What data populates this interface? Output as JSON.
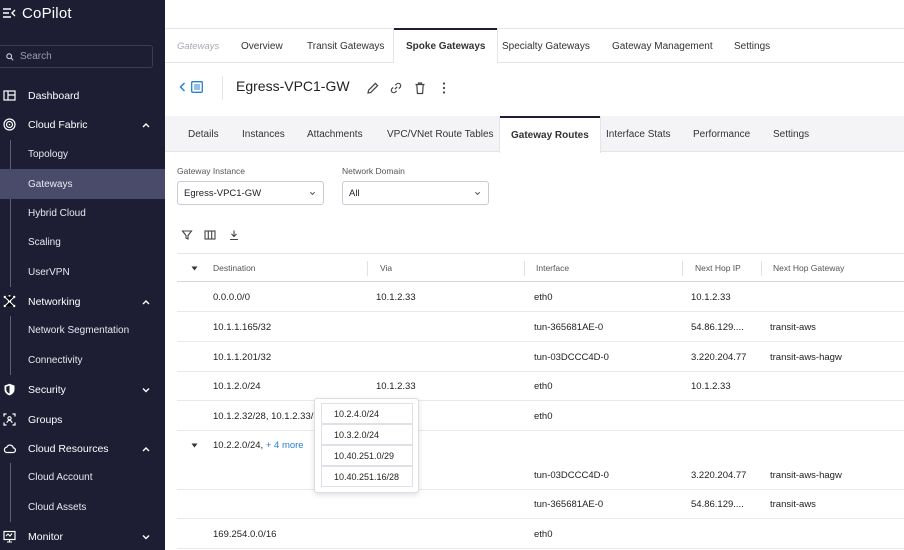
{
  "app": {
    "brand": "CoPilot"
  },
  "sidebar": {
    "search_placeholder": "Search",
    "items": [
      {
        "label": "Dashboard",
        "icon": "dashboard-icon"
      },
      {
        "label": "Cloud Fabric",
        "icon": "cloud-fabric-icon",
        "expanded": true
      },
      {
        "label": "Topology"
      },
      {
        "label": "Gateways",
        "active": true
      },
      {
        "label": "Hybrid Cloud"
      },
      {
        "label": "Scaling"
      },
      {
        "label": "UserVPN"
      },
      {
        "label": "Networking",
        "icon": "networking-icon",
        "expanded": true
      },
      {
        "label": "Network Segmentation"
      },
      {
        "label": "Connectivity"
      },
      {
        "label": "Security",
        "icon": "shield-icon",
        "expanded": false
      },
      {
        "label": "Groups",
        "icon": "groups-icon"
      },
      {
        "label": "Cloud Resources",
        "icon": "cloud-icon",
        "expanded": true
      },
      {
        "label": "Cloud Account"
      },
      {
        "label": "Cloud Assets"
      },
      {
        "label": "Monitor",
        "icon": "monitor-icon",
        "expanded": false
      }
    ]
  },
  "top_tabs": {
    "breadcrumb": "Gateways",
    "tabs": [
      "Overview",
      "Transit Gateways",
      "Spoke Gateways",
      "Specialty Gateways",
      "Gateway Management",
      "Settings"
    ],
    "active": "Spoke Gateways"
  },
  "header": {
    "title": "Egress-VPC1-GW"
  },
  "sub_tabs": {
    "tabs": [
      "Details",
      "Instances",
      "Attachments",
      "VPC/VNet Route Tables",
      "Gateway Routes",
      "Interface Stats",
      "Performance",
      "Settings"
    ],
    "active": "Gateway Routes"
  },
  "filters": {
    "gateway_instance": {
      "label": "Gateway Instance",
      "value": "Egress-VPC1-GW"
    },
    "network_domain": {
      "label": "Network Domain",
      "value": "All"
    }
  },
  "table": {
    "columns": [
      "Destination",
      "Via",
      "Interface",
      "Next Hop IP",
      "Next Hop Gateway"
    ],
    "rows": [
      {
        "destination": "0.0.0.0/0",
        "via": "10.1.2.33",
        "interface": "eth0",
        "next_hop_ip": "10.1.2.33",
        "next_hop_gateway": ""
      },
      {
        "destination": "10.1.1.165/32",
        "via": "",
        "interface": "tun-365681AE-0",
        "next_hop_ip": "54.86.129....",
        "next_hop_gateway": "transit-aws"
      },
      {
        "destination": "10.1.1.201/32",
        "via": "",
        "interface": "tun-03DCCC4D-0",
        "next_hop_ip": "3.220.204.77",
        "next_hop_gateway": "transit-aws-hagw"
      },
      {
        "destination": "10.1.2.0/24",
        "via": "10.1.2.33",
        "interface": "eth0",
        "next_hop_ip": "10.1.2.33",
        "next_hop_gateway": ""
      },
      {
        "destination": "10.1.2.32/28, 10.1.2.33/32",
        "via": "",
        "interface": "eth0",
        "next_hop_ip": "",
        "next_hop_gateway": ""
      },
      {
        "destination": "10.2.2.0/24,",
        "more": "+ 4 more",
        "via": "",
        "interface": "",
        "next_hop_ip": "",
        "next_hop_gateway": ""
      },
      {
        "destination": "",
        "via": "",
        "interface": "tun-03DCCC4D-0",
        "next_hop_ip": "3.220.204.77",
        "next_hop_gateway": "transit-aws-hagw"
      },
      {
        "destination": "",
        "via": "",
        "interface": "tun-365681AE-0",
        "next_hop_ip": "54.86.129....",
        "next_hop_gateway": "transit-aws"
      },
      {
        "destination": "169.254.0.0/16",
        "via": "",
        "interface": "eth0",
        "next_hop_ip": "",
        "next_hop_gateway": ""
      }
    ]
  },
  "popover": {
    "items": [
      "10.2.4.0/24",
      "10.3.2.0/24",
      "10.40.251.0/29",
      "10.40.251.16/28"
    ]
  }
}
